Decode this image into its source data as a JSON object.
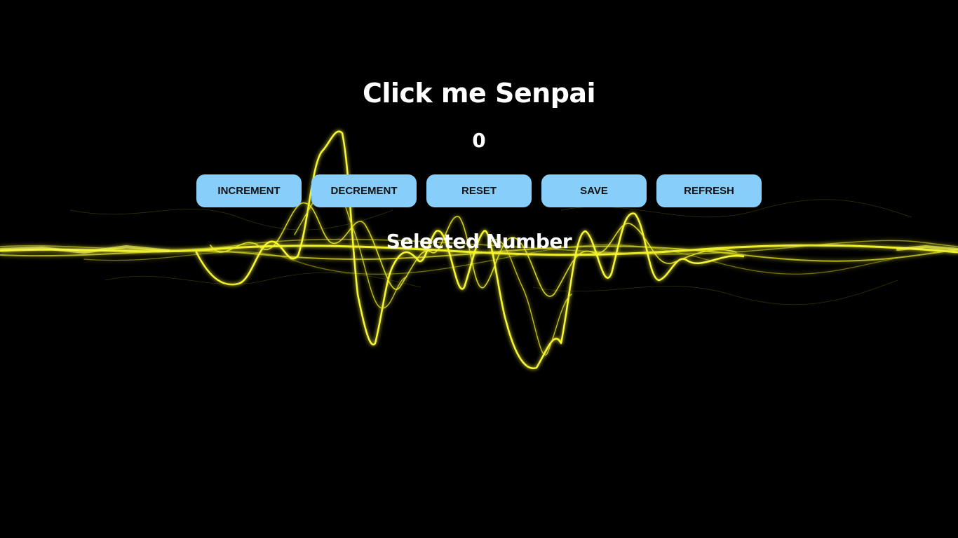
{
  "page": {
    "title": "Click me Senpai",
    "counter_value": "0",
    "selected_label": "Selected Number"
  },
  "buttons": {
    "increment": "INCREMENT",
    "decrement": "DECREMENT",
    "reset": "RESET",
    "save": "SAVE",
    "refresh": "REFRESH"
  },
  "colors": {
    "background": "#000000",
    "button_bg": "#87cefa",
    "button_text": "#111111",
    "text": "#ffffff",
    "wave": "#f2f22a"
  }
}
